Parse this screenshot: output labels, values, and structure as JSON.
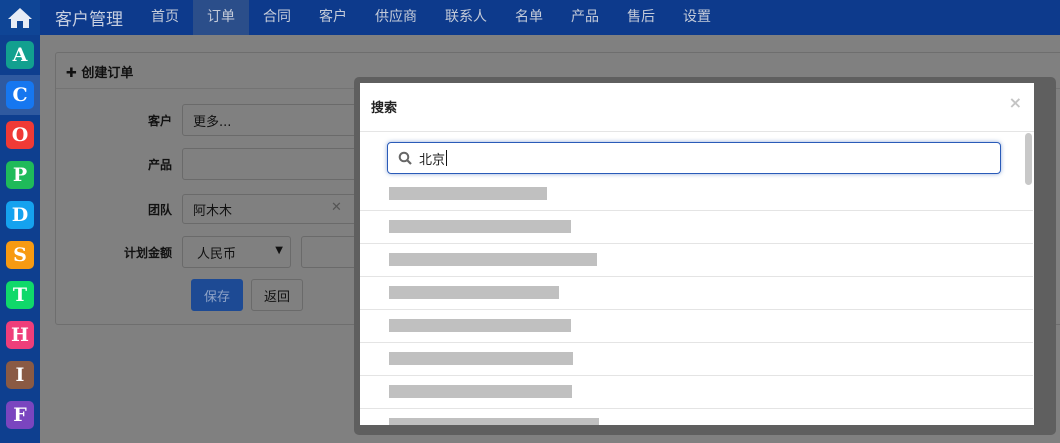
{
  "topbar": {
    "brand": "客户管理",
    "nav": [
      "首页",
      "订单",
      "合同",
      "客户",
      "供应商",
      "联系人",
      "名单",
      "产品",
      "售后",
      "设置"
    ],
    "active": "订单"
  },
  "sidebar": {
    "items": [
      {
        "letter": "A",
        "color": "#12a08f"
      },
      {
        "letter": "C",
        "color": "#1677f0"
      },
      {
        "letter": "O",
        "color": "#f03a36"
      },
      {
        "letter": "P",
        "color": "#1fba5a"
      },
      {
        "letter": "D",
        "color": "#15a2ef"
      },
      {
        "letter": "S",
        "color": "#f79a12"
      },
      {
        "letter": "T",
        "color": "#10d96a"
      },
      {
        "letter": "H",
        "color": "#ef3e7a"
      },
      {
        "letter": "I",
        "color": "#8a5a44"
      },
      {
        "letter": "F",
        "color": "#7a45bf"
      }
    ]
  },
  "form": {
    "title": "创建订单",
    "customer_label": "客户",
    "customer_value": "更多...",
    "product_label": "产品",
    "team_label": "团队",
    "team_value": "阿木木",
    "amount_label": "计划金额",
    "currency": "人民币",
    "save": "保存",
    "back": "返回"
  },
  "modal": {
    "title": "搜索",
    "close": "×",
    "search_value": "北京",
    "results_count": 8
  }
}
